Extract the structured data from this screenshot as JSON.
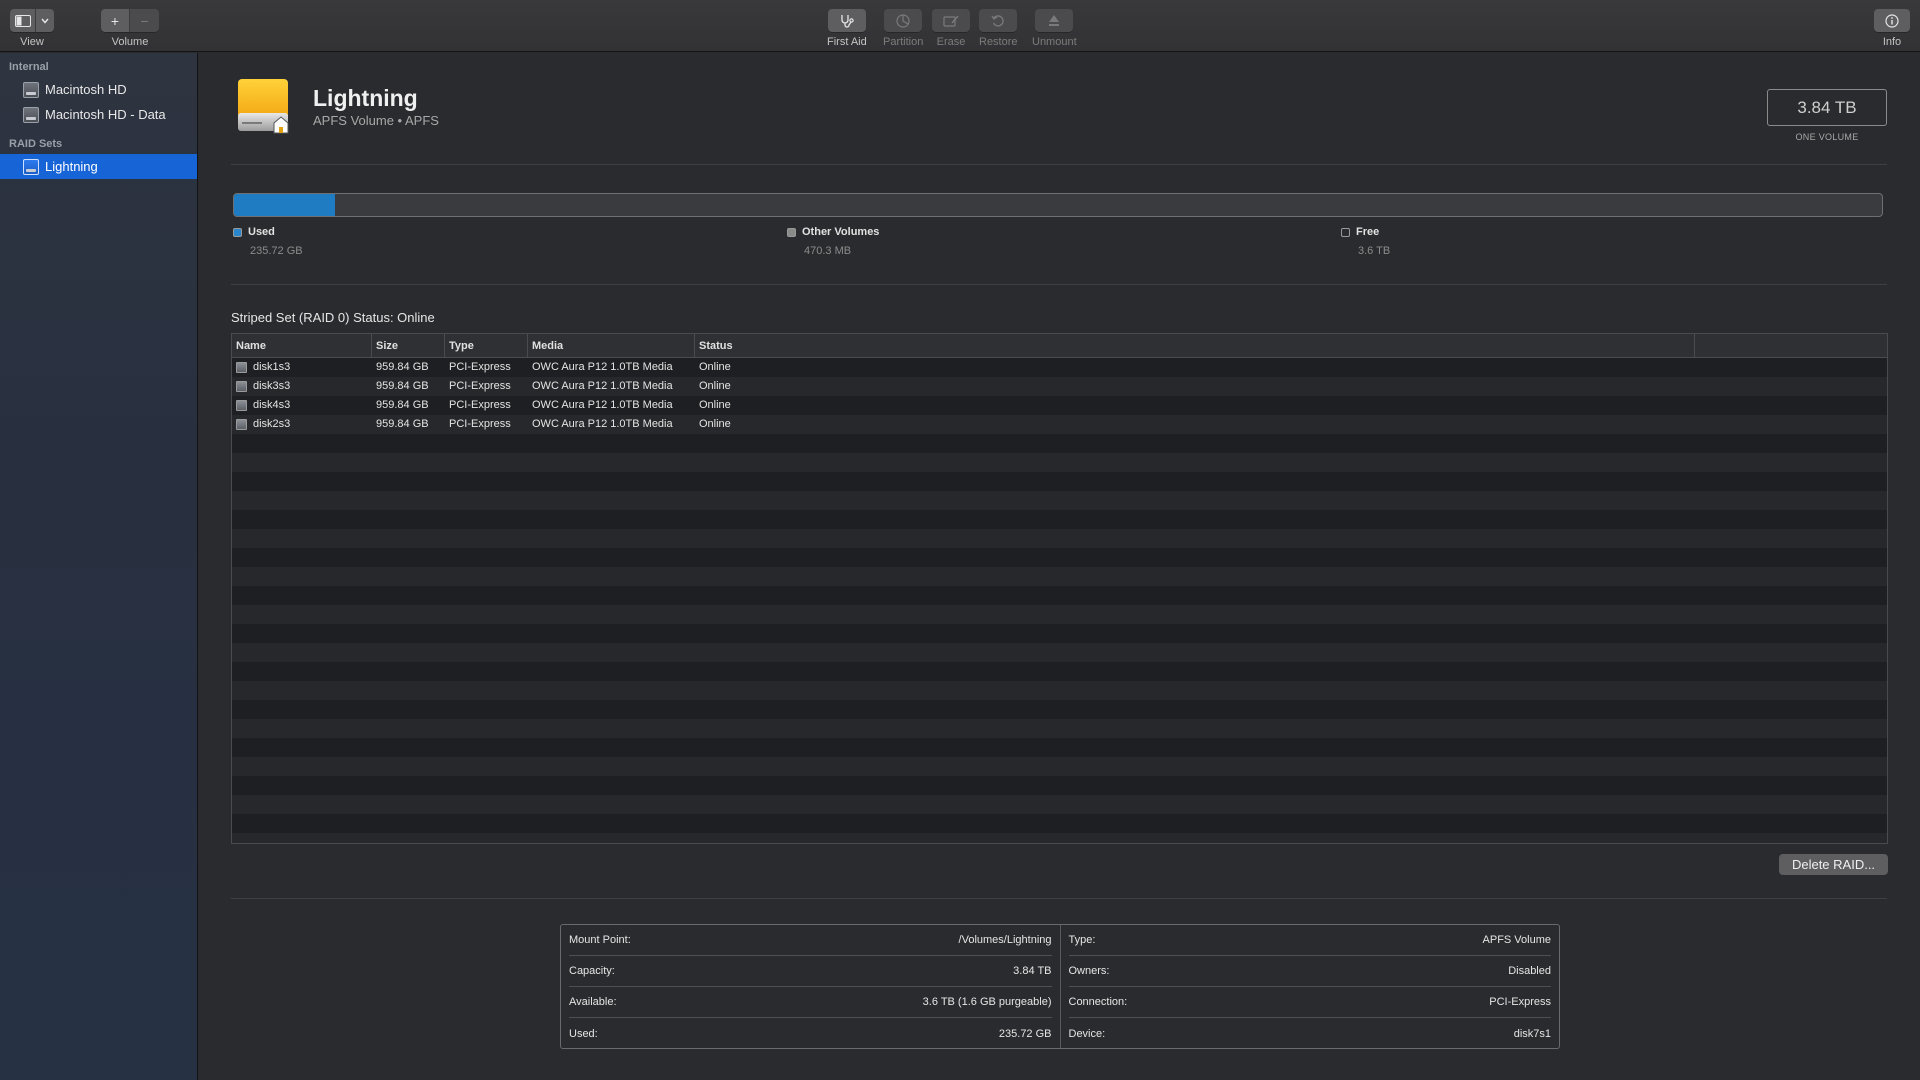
{
  "toolbar": {
    "view_label": "View",
    "volume_label": "Volume",
    "first_aid_label": "First Aid",
    "partition_label": "Partition",
    "erase_label": "Erase",
    "restore_label": "Restore",
    "unmount_label": "Unmount",
    "info_label": "Info"
  },
  "sidebar": {
    "sections": [
      {
        "title": "Internal",
        "items": [
          {
            "label": "Macintosh HD"
          },
          {
            "label": "Macintosh HD - Data"
          }
        ]
      },
      {
        "title": "RAID Sets",
        "items": [
          {
            "label": "Lightning",
            "selected": true
          }
        ]
      }
    ]
  },
  "volume": {
    "name": "Lightning",
    "subtitle": "APFS Volume • APFS",
    "size": "3.84 TB",
    "size_caption": "ONE VOLUME"
  },
  "usage": {
    "used_fraction": 0.0614,
    "used_color": "#1f7cc2",
    "legend": [
      {
        "label": "Used",
        "value": "235.72 GB",
        "color": "#2a86cc"
      },
      {
        "label": "Other Volumes",
        "value": "470.3 MB",
        "color": "#8a8a8a"
      },
      {
        "label": "Free",
        "value": "3.6 TB",
        "color": "#2a2b2e"
      }
    ]
  },
  "raid": {
    "status": "Striped Set (RAID 0) Status: Online",
    "columns": [
      "Name",
      "Size",
      "Type",
      "Media",
      "Status"
    ],
    "rows": [
      {
        "name": "disk1s3",
        "size": "959.84 GB",
        "type": "PCI-Express",
        "media": "OWC Aura P12 1.0TB Media",
        "status": "Online"
      },
      {
        "name": "disk3s3",
        "size": "959.84 GB",
        "type": "PCI-Express",
        "media": "OWC Aura P12 1.0TB Media",
        "status": "Online"
      },
      {
        "name": "disk4s3",
        "size": "959.84 GB",
        "type": "PCI-Express",
        "media": "OWC Aura P12 1.0TB Media",
        "status": "Online"
      },
      {
        "name": "disk2s3",
        "size": "959.84 GB",
        "type": "PCI-Express",
        "media": "OWC Aura P12 1.0TB Media",
        "status": "Online"
      }
    ],
    "delete_label": "Delete RAID..."
  },
  "info": {
    "left": [
      {
        "key": "Mount Point:",
        "value": "/Volumes/Lightning"
      },
      {
        "key": "Capacity:",
        "value": "3.84 TB"
      },
      {
        "key": "Available:",
        "value": "3.6 TB (1.6 GB purgeable)"
      },
      {
        "key": "Used:",
        "value": "235.72 GB"
      }
    ],
    "right": [
      {
        "key": "Type:",
        "value": "APFS Volume"
      },
      {
        "key": "Owners:",
        "value": "Disabled"
      },
      {
        "key": "Connection:",
        "value": "PCI-Express"
      },
      {
        "key": "Device:",
        "value": "disk7s1"
      }
    ]
  }
}
